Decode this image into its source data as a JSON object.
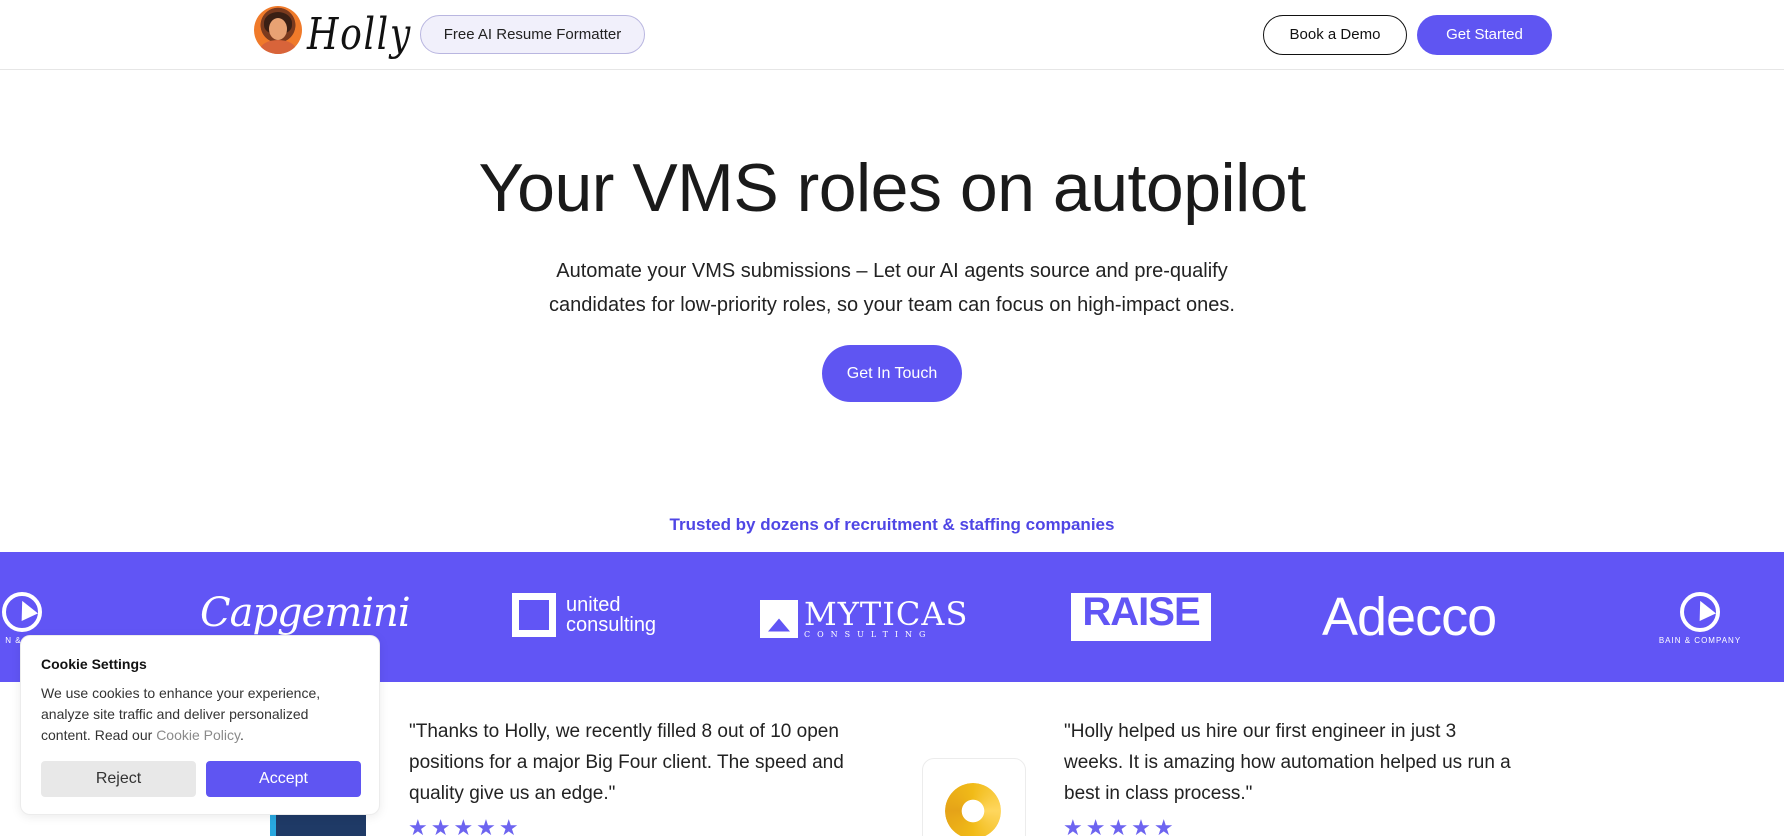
{
  "header": {
    "logo_text": "Holly",
    "free_tool_label": "Free AI Resume Formatter",
    "book_demo_label": "Book a Demo",
    "get_started_label": "Get Started"
  },
  "hero": {
    "title": "Your VMS roles on autopilot",
    "subtitle_line1": "Automate your VMS submissions – Let our AI agents source and pre-qualify",
    "subtitle_line2": "candidates for low-priority roles, so your team can focus on high-impact ones.",
    "cta_label": "Get In Touch"
  },
  "trusted": {
    "heading": "Trusted by dozens of recruitment & staffing companies",
    "logos": {
      "bain_caption": "BAIN & COMPANY",
      "bain_partial_caption": "N & CO",
      "capgemini": "Capgemini",
      "united_line1": "united",
      "united_line2": "consulting",
      "myticas": "MYTICAS",
      "myticas_sub": "CONSULTING",
      "raise": "RAISE",
      "adecco": "Adecco"
    },
    "band_color": "#6155f5"
  },
  "testimonials": [
    {
      "quote_line1": "\"Thanks to Holly, we recently filled 8 out of 10 open",
      "quote_line2": "positions for a major Big Four client. The speed and",
      "quote_line3": "quality give us an edge.\"",
      "stars": "★★★★★"
    },
    {
      "quote_line1": "\"Holly helped us hire our first engineer in just 3",
      "quote_line2": "weeks. It is amazing how automation helped us run a",
      "quote_line3": "best in class process.\"",
      "stars": "★★★★★"
    }
  ],
  "cookie": {
    "title": "Cookie Settings",
    "text": "We use cookies to enhance your experience, analyze site traffic and deliver personalized content. Read our ",
    "link_text": "Cookie Policy",
    "period": ".",
    "reject_label": "Reject",
    "accept_label": "Accept"
  },
  "colors": {
    "accent": "#5f55f2",
    "trusted_text": "#4f46e5",
    "star": "#6d64f0"
  }
}
